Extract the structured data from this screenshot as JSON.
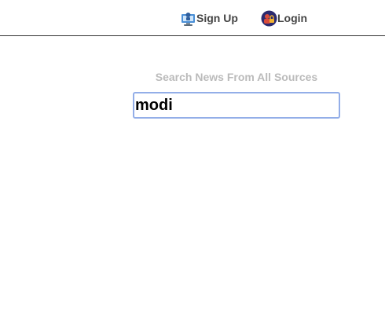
{
  "nav": {
    "signup": {
      "label": "Sign Up",
      "icon": "computer-user-icon"
    },
    "login": {
      "label": "Login",
      "icon": "lock-user-icon"
    }
  },
  "search": {
    "label": "Search News From All Sources",
    "value": "modi"
  },
  "colors": {
    "divider": "#333333",
    "nav_text": "#444444",
    "label_text": "#bbbbbb",
    "input_border": "#93aee8"
  }
}
